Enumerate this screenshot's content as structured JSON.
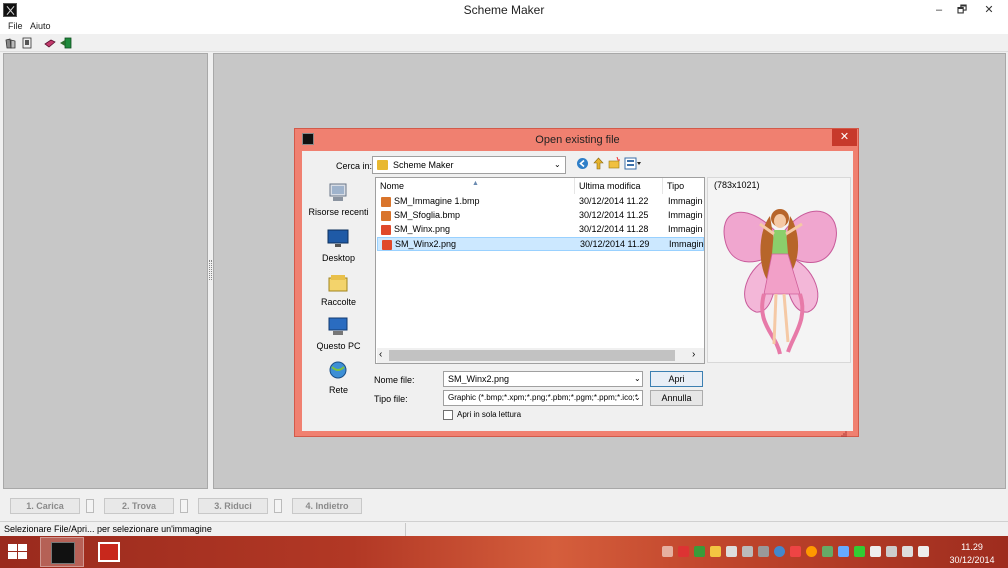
{
  "window": {
    "title": "Scheme Maker",
    "controls": [
      "–",
      "🗗",
      "✕"
    ]
  },
  "menu": [
    "File",
    "Aiuto"
  ],
  "toolbar": {
    "icons": [
      "open-icon",
      "new-icon",
      "book-icon",
      "export-icon"
    ]
  },
  "steps": [
    "1. Carica",
    "2. Trova",
    "3. Riduci",
    "4. Indietro"
  ],
  "status": "Selezionare File/Apri... per selezionare un'immagine",
  "taskbar": {
    "time": "11.29",
    "date": "30/12/2014"
  },
  "dialog": {
    "title": "Open existing file",
    "close": "✕",
    "look_in_label": "Cerca in:",
    "look_in_value": "Scheme Maker",
    "places": [
      "Risorse recenti",
      "Desktop",
      "Raccolte",
      "Questo PC",
      "Rete"
    ],
    "columns": [
      "Nome",
      "Ultima modifica",
      "Tipo"
    ],
    "files": [
      {
        "name": "SM_Immagine 1.bmp",
        "date": "30/12/2014 11.22",
        "type": "Immagine",
        "selected": false
      },
      {
        "name": "SM_Sfoglia.bmp",
        "date": "30/12/2014 11.25",
        "type": "Immagine",
        "selected": false
      },
      {
        "name": "SM_Winx.png",
        "date": "30/12/2014 11.28",
        "type": "Immagine",
        "selected": false
      },
      {
        "name": "SM_Winx2.png",
        "date": "30/12/2014 11.29",
        "type": "Immagine",
        "selected": true
      }
    ],
    "preview_dimensions": "(783x1021)",
    "file_name_label": "Nome file:",
    "file_name_value": "SM_Winx2.png",
    "file_type_label": "Tipo file:",
    "file_type_value": "Graphic (*.bmp;*.xpm;*.png;*.pbm;*.pgm;*.ppm;*.ico;*",
    "open_button": "Apri",
    "cancel_button": "Annulla",
    "readonly_label": "Apri in sola lettura"
  },
  "colors": {
    "dialog_border": "#f08070",
    "close_button": "#c7392b",
    "selection": "#cce8ff",
    "panel_gray": "#c7c7c7"
  }
}
